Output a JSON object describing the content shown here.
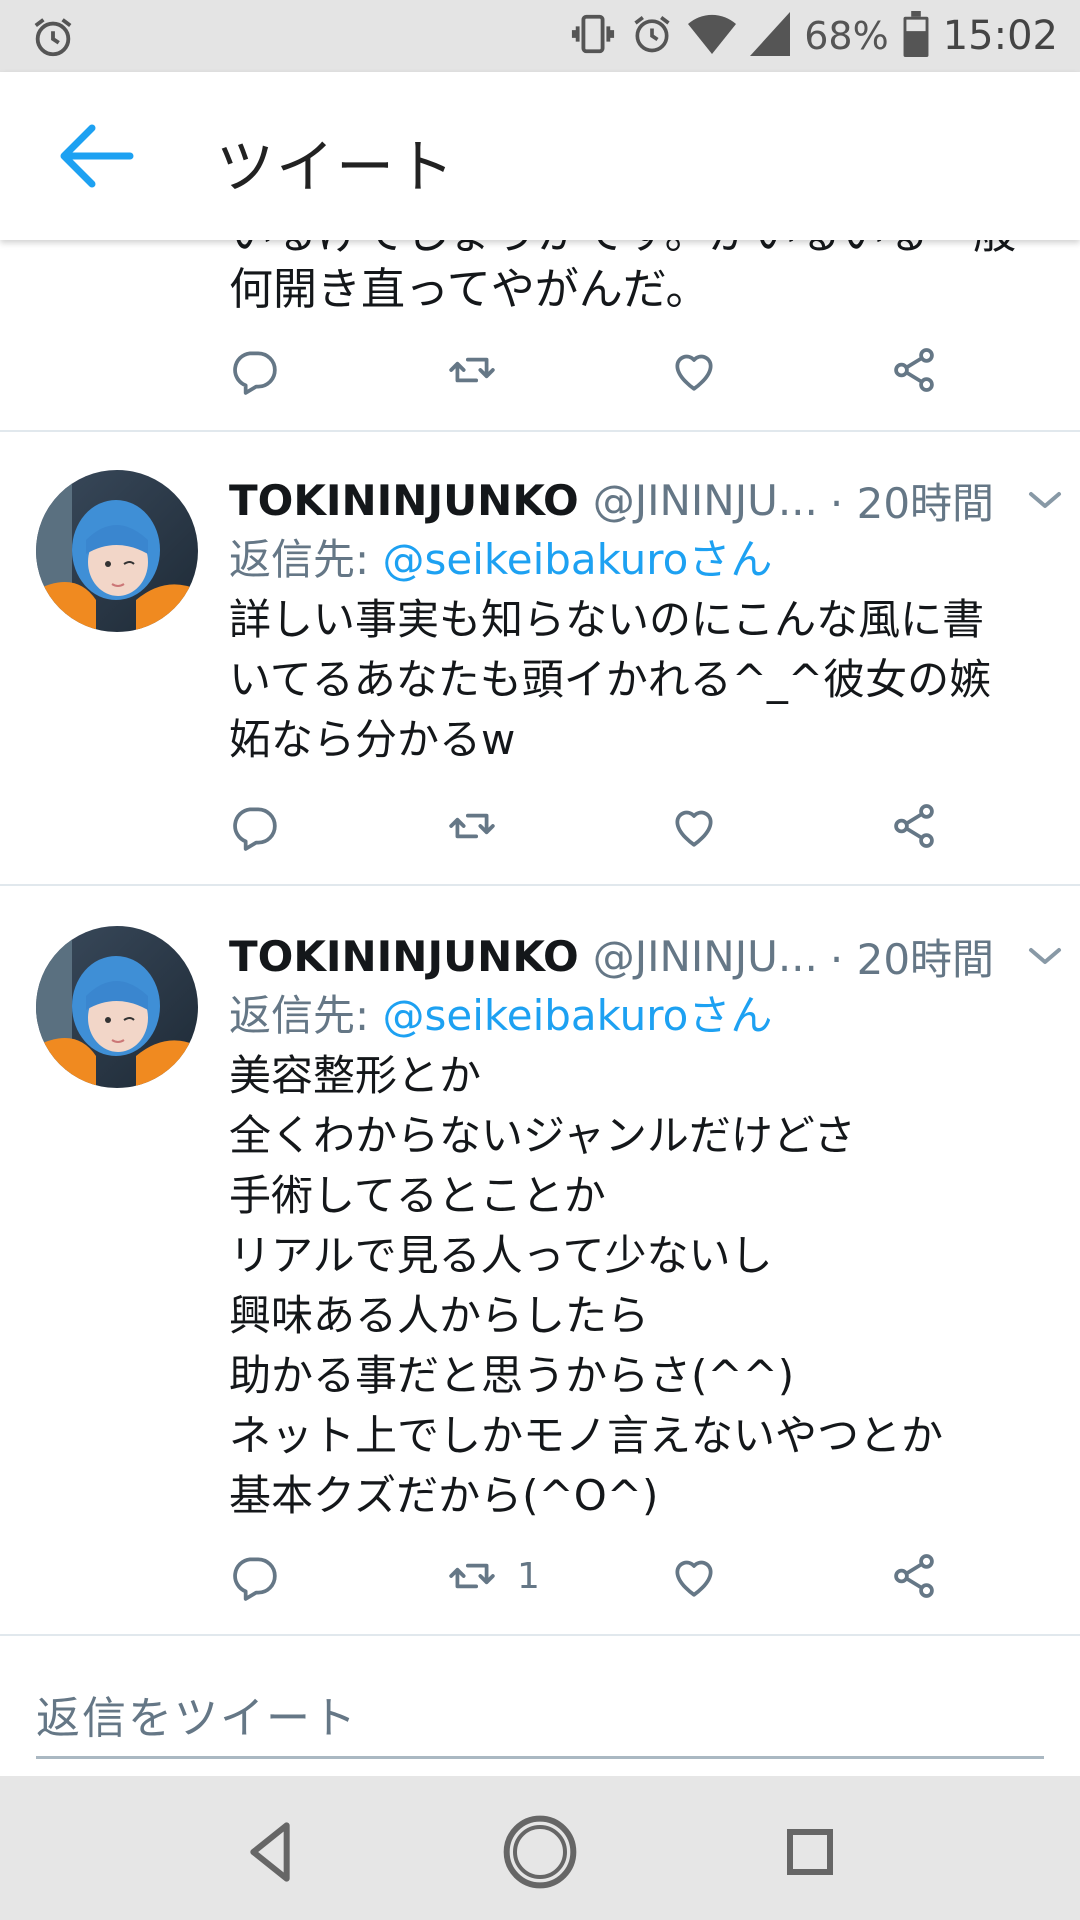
{
  "status_bar": {
    "battery": "68%",
    "time": "15:02",
    "icons": [
      "alarm-icon",
      "vibrate-icon",
      "alarm-icon",
      "wifi-icon",
      "signal-icon",
      "battery-icon"
    ]
  },
  "app_bar": {
    "title": "ツイート",
    "back_icon": "arrow-left-icon"
  },
  "partial_tweet": {
    "cut_line": "いるげでしょうかです。がいるいる一般",
    "last_line": "何開き直ってやがんだ。",
    "retweet_count": "",
    "like_count": ""
  },
  "tweets": [
    {
      "name": "TOKININJUNKO",
      "handle": "@JININJU...",
      "time": "· 20時間",
      "reply_label": "返信先:",
      "reply_mention": "@seikeibakuroさん",
      "lines": [
        "詳しい事実も知らないのにこんな風に書",
        "いてるあなたも頭イかれる^_^彼女の嫉",
        "妬なら分かるw"
      ],
      "retweet_count": "",
      "like_count": ""
    },
    {
      "name": "TOKININJUNKO",
      "handle": "@JININJU...",
      "time": "· 20時間",
      "reply_label": "返信先:",
      "reply_mention": "@seikeibakuroさん",
      "lines": [
        "美容整形とか",
        "全くわからないジャンルだけどさ",
        "手術してるとことか",
        "リアルで見る人って少ないし",
        "興味ある人からしたら",
        "助かる事だと思うからさ(^^)",
        "ネット上でしかモノ言えないやつとか",
        "基本クズだから(^O^)"
      ],
      "retweet_count": "1",
      "like_count": ""
    }
  ],
  "composer": {
    "placeholder": "返信をツイート"
  },
  "nav_bar": {
    "icons": [
      "back-triangle-icon",
      "home-circle-icon",
      "recents-square-icon"
    ]
  },
  "colors": {
    "accent": "#1da1f2",
    "secondary_text": "#657786",
    "primary_text": "#14171a",
    "divider": "#e1e8ed",
    "status_bar_bg": "#e4e4e4",
    "nav_bar_bg": "#e6e6e6"
  }
}
